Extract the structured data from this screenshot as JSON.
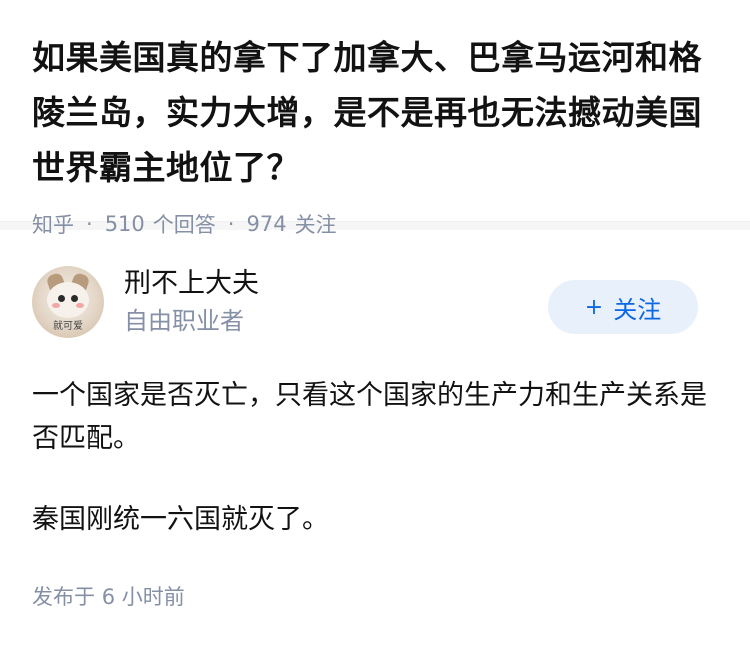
{
  "question": {
    "title": "如果美国真的拿下了加拿大、巴拿马运河和格陵兰岛，实力大增，是不是再也无法撼动美国世界霸主地位了？",
    "source": "知乎",
    "answers_count": "510",
    "answers_label": "个回答",
    "followers_count": "974",
    "followers_label": "关注"
  },
  "answer": {
    "author_name": "刑不上大夫",
    "author_desc": "自由职业者",
    "avatar_caption": "就可爱",
    "follow_label": "关注",
    "follow_icon": "plus-icon",
    "paragraphs": [
      "一个国家是否灭亡，只看这个国家的生产力和生产关系是否匹配。",
      "秦国刚统一六国就灭了。"
    ],
    "publish_prefix": "发布于",
    "publish_time": "6 小时前"
  },
  "colors": {
    "meta": "#8590a6",
    "accent": "#0c66e4",
    "follow_bg": "#e8f1fb"
  }
}
